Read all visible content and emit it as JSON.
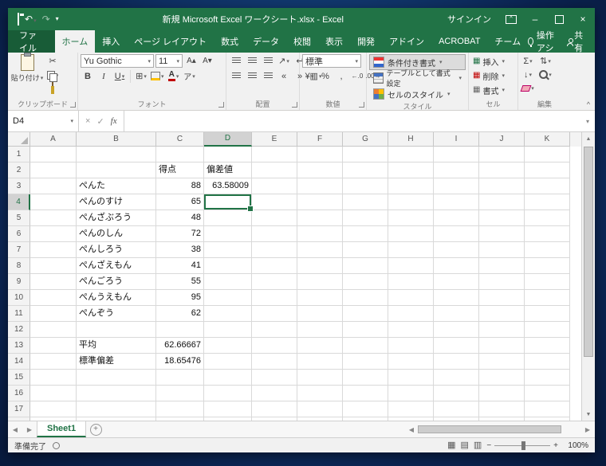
{
  "titlebar": {
    "title": "新規 Microsoft Excel ワークシート.xlsx  -  Excel",
    "signin": "サインイン"
  },
  "tabs": {
    "file": "ファイル",
    "active": "ホーム",
    "items": [
      "ホーム",
      "挿入",
      "ページ レイアウト",
      "数式",
      "データ",
      "校閲",
      "表示",
      "開発",
      "アドイン",
      "ACROBAT",
      "チーム"
    ],
    "assistant": "操作アシ",
    "share": "共有"
  },
  "ribbon": {
    "clipboard": {
      "label": "クリップボード",
      "paste": "貼り付け"
    },
    "font": {
      "label": "フォント",
      "name": "Yu Gothic",
      "size": "11",
      "bold": "B",
      "italic": "I",
      "underline": "U",
      "phonetic": "ア"
    },
    "alignment": {
      "label": "配置"
    },
    "number": {
      "label": "数値",
      "format": "標準",
      "currency": "¥",
      "percent": "%",
      "comma": ",",
      "inc_decimal": "←.0",
      "dec_decimal": ".00→"
    },
    "styles": {
      "label": "スタイル",
      "conditional": "条件付き書式",
      "table": "テーブルとして書式設定",
      "cell": "セルのスタイル"
    },
    "cells": {
      "label": "セル",
      "insert": "挿入",
      "delete": "削除",
      "format": "書式"
    },
    "editing": {
      "label": "編集",
      "autosum": "Σ"
    }
  },
  "formula": {
    "name_box": "D4",
    "cancel": "×",
    "enter": "✓",
    "fx": "fx"
  },
  "grid": {
    "columns": [
      "A",
      "B",
      "C",
      "D",
      "E",
      "F",
      "G",
      "H",
      "I",
      "J",
      "K"
    ],
    "row_count": 18,
    "selected": {
      "col": "D",
      "row": 4
    },
    "cells": {
      "C2": "得点",
      "D2": "偏差値",
      "B3": "ぺんた",
      "C3": "88",
      "D3": "63.58009",
      "B4": "ぺんのすけ",
      "C4": "65",
      "B5": "ぺんざぶろう",
      "C5": "48",
      "B6": "ぺんのしん",
      "C6": "72",
      "B7": "ぺんしろう",
      "C7": "38",
      "B8": "ぺんざえもん",
      "C8": "41",
      "B9": "ぺんごろう",
      "C9": "55",
      "B10": "ぺんうえもん",
      "C10": "95",
      "B11": "ぺんぞう",
      "C11": "62",
      "B13": "平均",
      "C13": "62.66667",
      "B14": "標準偏差",
      "C14": "18.65476"
    }
  },
  "sheet": {
    "active": "Sheet1"
  },
  "status": {
    "ready": "準備完了",
    "zoom": "100%"
  },
  "icons": {
    "undo": "↶",
    "redo": "↷",
    "cut": "✂",
    "borders": "⊞",
    "dropdown": "▾",
    "orientation": "↗",
    "wrap": "↩",
    "merge": "▥",
    "indent_dec": "«",
    "indent_inc": "»",
    "fill_down": "↓",
    "sort": "⇅",
    "font_grow": "A▴",
    "font_shrink": "A▾",
    "view_normal": "▦",
    "view_layout": "▤",
    "view_break": "▥",
    "minimize": "–",
    "close": "×"
  },
  "colors": {
    "accent": "#217346",
    "title_bar": "#217346",
    "file_tab": "#185c37",
    "ribbon_bg": "#f1f1f1",
    "grid_line": "#d9d9d9",
    "header_bg": "#f3f3f3",
    "selected_header_bg": "#d2d2d2",
    "desktop": "#14407a"
  }
}
